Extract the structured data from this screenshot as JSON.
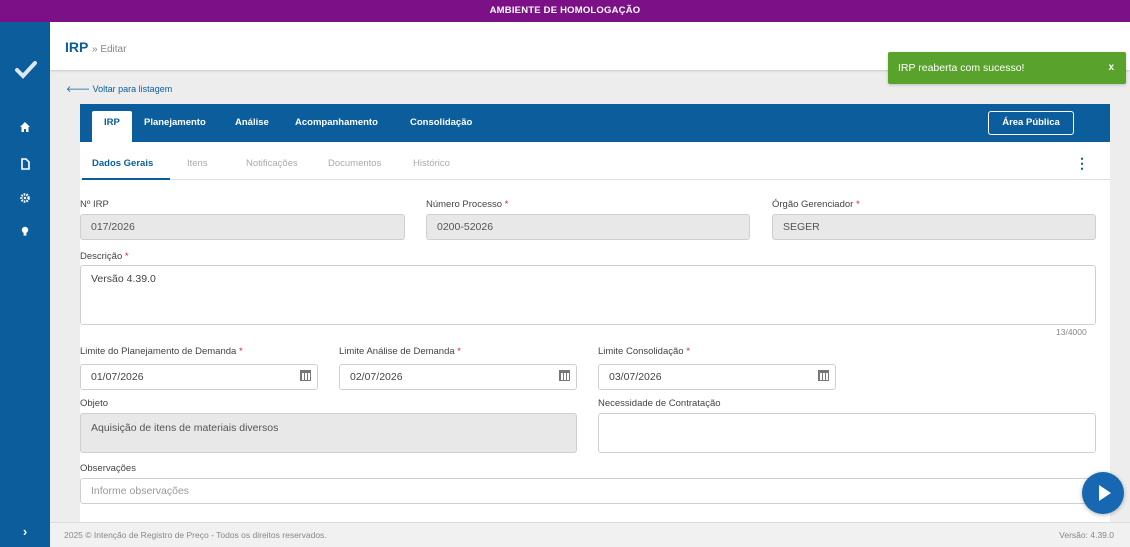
{
  "environment_banner": "AMBIENTE DE HOMOLOGAÇÃO",
  "page": {
    "title": "IRP",
    "subtitle": "» Editar",
    "back_link": "Voltar para listagem"
  },
  "toast": {
    "message": "IRP reaberta com sucesso!",
    "close": "x",
    "color": "#59a32d"
  },
  "main_tabs": [
    "IRP",
    "Planejamento",
    "Análise",
    "Acompanhamento",
    "Consolidação"
  ],
  "public_area_button": "Área Pública",
  "sub_tabs": [
    "Dados Gerais",
    "Itens",
    "Notificações",
    "Documentos",
    "Histórico"
  ],
  "form": {
    "irp_number": {
      "label": "Nº IRP",
      "value": "017/2026"
    },
    "process_number": {
      "label": "Número Processo",
      "value": "0200-52026"
    },
    "managing_agency": {
      "label": "Órgão Gerenciador",
      "value": "SEGER"
    },
    "description": {
      "label": "Descrição",
      "value": "Versão 4.39.0",
      "counter": "13/4000"
    },
    "demand_planning_limit": {
      "label": "Limite do Planejamento de Demanda",
      "value": "01/07/2026"
    },
    "demand_analysis_limit": {
      "label": "Limite Análise de Demanda",
      "value": "02/07/2026"
    },
    "consolidation_limit": {
      "label": "Limite Consolidação",
      "value": "03/07/2026"
    },
    "object": {
      "label": "Objeto",
      "value": "Aquisição de itens de materiais diversos"
    },
    "contracting_need": {
      "label": "Necessidade de Contratação",
      "value": ""
    },
    "observations": {
      "label": "Observações",
      "placeholder": "Informe observações"
    },
    "required_mark": "*"
  },
  "footer": {
    "copyright": "2025 © Intenção de Registro de Preço - Todos os direitos reservados.",
    "version": "Versão: 4.39.0"
  },
  "sidebar": {
    "icons": [
      "check-logo-icon",
      "home-icon",
      "document-icon",
      "gear-icon",
      "lightbulb-icon",
      "chevron-right-icon"
    ]
  },
  "colors": {
    "brand": "#0b5d9c",
    "env_banner": "#7b1087",
    "required": "#e01f2b"
  }
}
